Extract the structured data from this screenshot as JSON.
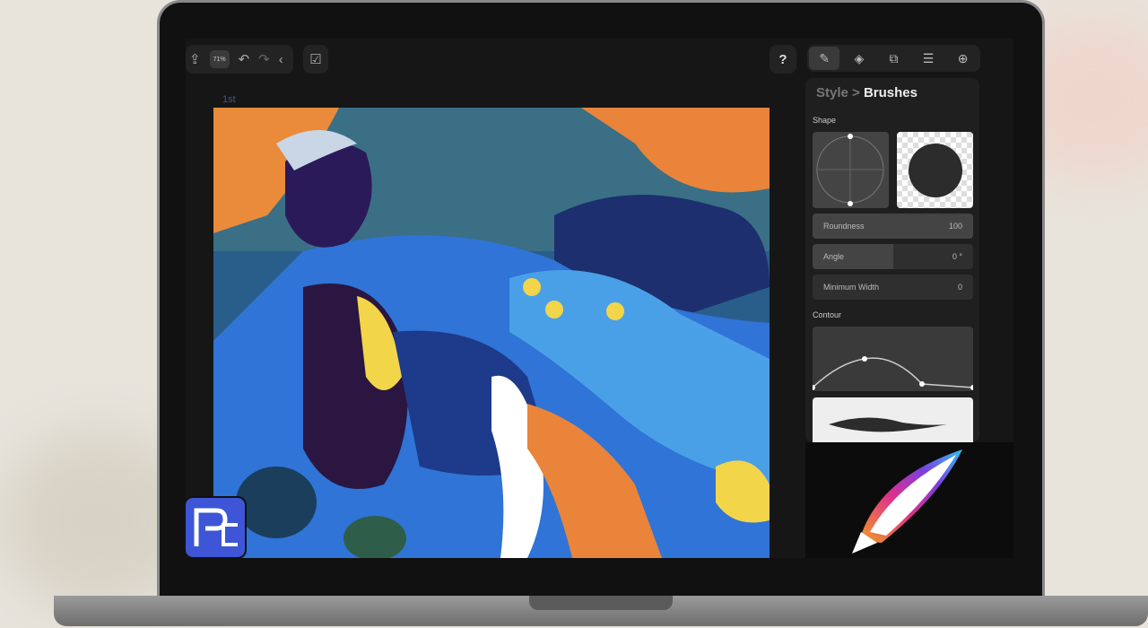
{
  "toolbar": {
    "zoom_level": "71%",
    "help_label": "?"
  },
  "canvas": {
    "layer_label": "1st"
  },
  "panel": {
    "tabs": [
      "brush-style",
      "transform",
      "shapes",
      "layers",
      "add"
    ],
    "breadcrumb": {
      "parent": "Style",
      "separator": ">",
      "current": "Brushes"
    },
    "shape_label": "Shape",
    "rows": [
      {
        "label": "Roundness",
        "value": "100",
        "fill": 1.0
      },
      {
        "label": "Angle",
        "value": "0 °",
        "fill": 0.5
      },
      {
        "label": "Minimum Width",
        "value": "0",
        "fill": 0
      }
    ],
    "contour_label": "Contour"
  },
  "colors": {
    "accent": "#3d55d6",
    "panel": "#1f1f1f"
  }
}
